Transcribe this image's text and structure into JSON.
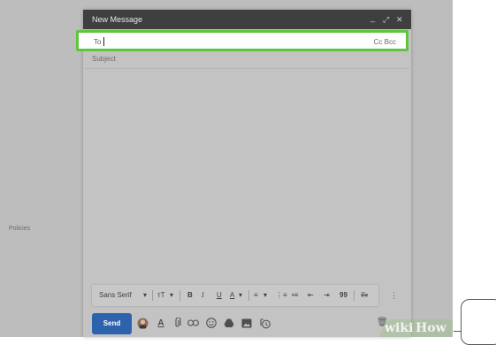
{
  "sidebar": {
    "policies": "Policies"
  },
  "compose": {
    "title": "New Message",
    "controls": {
      "minimize": "_",
      "expand": "⤢",
      "close": "✕"
    },
    "to_label": "To",
    "cc_bcc": "Cc Bcc",
    "subject_placeholder": "Subject"
  },
  "format_toolbar": {
    "font": "Sans Serif",
    "font_caret": "▾",
    "size": "тT",
    "size_caret": "▾",
    "bold": "B",
    "italic": "I",
    "underline": "U",
    "text_color": "A",
    "color_caret": "▾",
    "align": "≡",
    "align_caret": "▾",
    "numbered_list": "⋮≡",
    "bulleted_list": "•≡",
    "indent_less": "⇤",
    "indent_more": "⇥",
    "quote": "99",
    "remove_format": "Tx"
  },
  "bottom_bar": {
    "send": "Send",
    "icons": [
      "avatar-icon",
      "format-text-icon",
      "attach-icon",
      "link-icon",
      "emoji-icon",
      "drive-icon",
      "photo-icon",
      "confidential-icon"
    ]
  },
  "watermark": {
    "wiki": "wiki",
    "how": "How"
  },
  "colors": {
    "titlebar": "#3f3f3f",
    "highlight": "#5fc53d",
    "send": "#2d62ad",
    "overlay": "#bdbdbd"
  }
}
